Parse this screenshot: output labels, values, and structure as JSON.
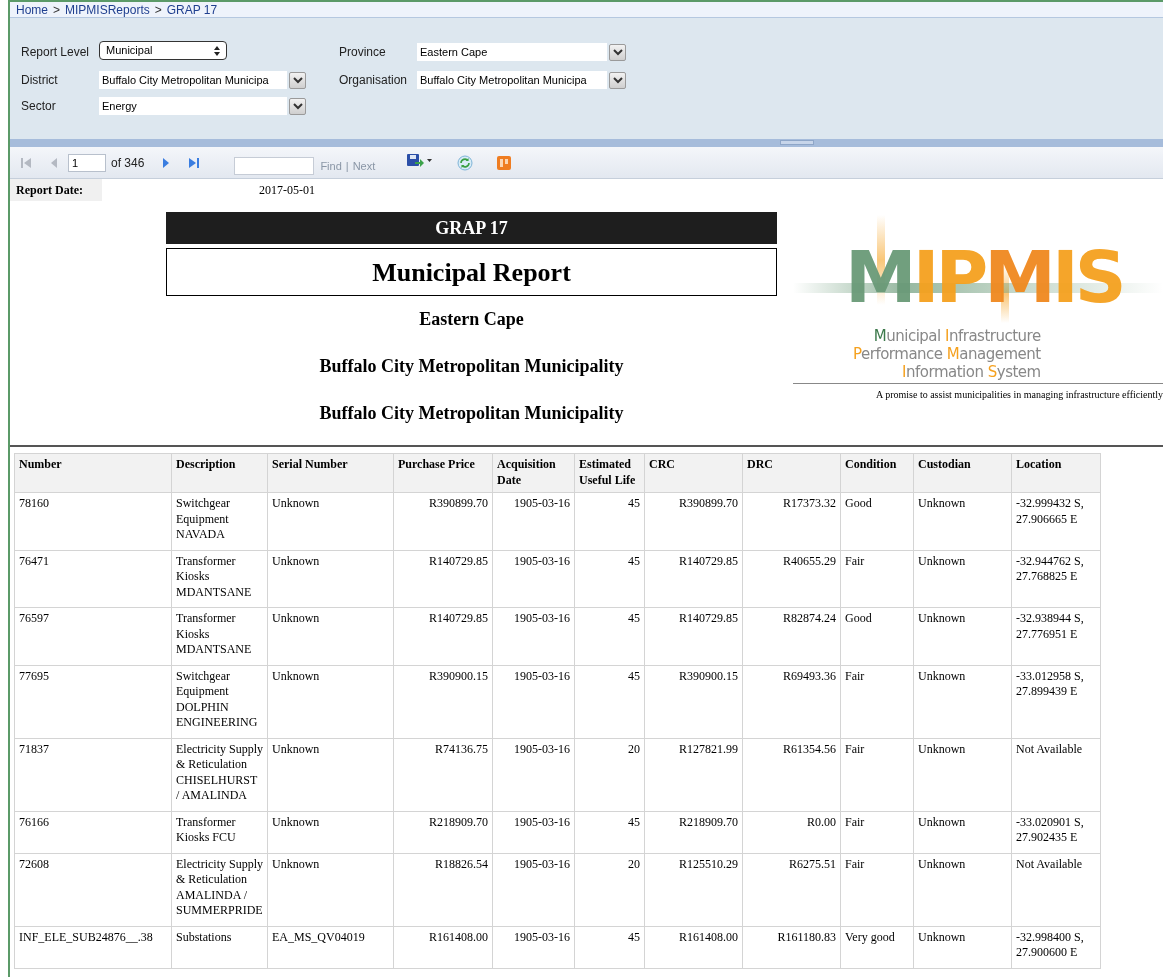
{
  "breadcrumb": [
    {
      "label": "Home",
      "separator": ">"
    },
    {
      "label": "MIPMISReports",
      "separator": ">"
    },
    {
      "label": "GRAP 17"
    }
  ],
  "filters": [
    {
      "label": "Report Level",
      "value": "Municipal",
      "kind": "select"
    },
    {
      "label": "Province",
      "value": "Eastern Cape",
      "kind": "combo"
    },
    {
      "label": "District",
      "value": "Buffalo City Metropolitan Municipa",
      "kind": "combo"
    },
    {
      "label": "Organisation",
      "value": "Buffalo City Metropolitan Municipa",
      "kind": "combo"
    },
    {
      "label": "Sector",
      "value": "Energy",
      "kind": "combo"
    }
  ],
  "toolbar": {
    "page": "1",
    "of": "of 346",
    "find": "Find",
    "separator": "|",
    "next": "Next"
  },
  "report": {
    "date_label": "Report Date:",
    "date": "2017-05-01",
    "banner": "GRAP 17",
    "title": "Municipal Report",
    "subtitles": [
      "Eastern Cape",
      "Buffalo City Metropolitan Municipality",
      "Buffalo City Metropolitan Municipality"
    ],
    "logo": {
      "letters": [
        {
          "char": "M",
          "color": "#6a9a78"
        },
        {
          "char": "I",
          "color": "#f5a11f"
        },
        {
          "char": "P",
          "color": "#f5a11f"
        },
        {
          "char": "M",
          "color": "#f0891f"
        },
        {
          "char": "I",
          "color": "#f5a11f"
        },
        {
          "char": "S",
          "color": "#f5a11f"
        }
      ],
      "lines": [
        "Municipal Infrastructure",
        "Performance Management",
        "Information System"
      ]
    },
    "tagline": "A promise to assist municipalities in managing infrastructure efficiently"
  },
  "table": {
    "columns": [
      "Number",
      "Description",
      "Serial Number",
      "Purchase Price",
      "Acquisition Date",
      "Estimated Useful Life",
      "CRC",
      "DRC",
      "Condition",
      "Custodian",
      "Location"
    ],
    "rows": [
      [
        "78160",
        "Switchgear Equipment NAVADA",
        "Unknown",
        "R390899.70",
        "1905-03-16",
        "45",
        "R390899.70",
        "R17373.32",
        "Good",
        "Unknown",
        "-32.999432 S, 27.906665 E"
      ],
      [
        "76471",
        "Transformer Kiosks MDANTSANE",
        "Unknown",
        "R140729.85",
        "1905-03-16",
        "45",
        "R140729.85",
        "R40655.29",
        "Fair",
        "Unknown",
        "-32.944762 S, 27.768825 E"
      ],
      [
        "76597",
        "Transformer Kiosks MDANTSANE",
        "Unknown",
        "R140729.85",
        "1905-03-16",
        "45",
        "R140729.85",
        "R82874.24",
        "Good",
        "Unknown",
        "-32.938944 S, 27.776951 E"
      ],
      [
        "77695",
        "Switchgear Equipment DOLPHIN ENGINEERING",
        "Unknown",
        "R390900.15",
        "1905-03-16",
        "45",
        "R390900.15",
        "R69493.36",
        "Fair",
        "Unknown",
        "-33.012958 S, 27.899439 E"
      ],
      [
        "71837",
        "Electricity Supply & Reticulation CHISELHURST / AMALINDA",
        "Unknown",
        "R74136.75",
        "1905-03-16",
        "20",
        "R127821.99",
        "R61354.56",
        "Fair",
        "Unknown",
        "Not Available"
      ],
      [
        "76166",
        "Transformer Kiosks  FCU",
        "Unknown",
        "R218909.70",
        "1905-03-16",
        "45",
        "R218909.70",
        "R0.00",
        "Fair",
        "Unknown",
        "-33.020901 S, 27.902435 E"
      ],
      [
        "72608",
        "Electricity Supply & Reticulation AMALINDA / SUMMERPRIDE",
        "Unknown",
        "R18826.54",
        "1905-03-16",
        "20",
        "R125510.29",
        "R6275.51",
        "Fair",
        "Unknown",
        "Not Available"
      ],
      [
        "INF_ELE_SUB24876__.38",
        "Substations",
        "EA_MS_QV04019",
        "R161408.00",
        "1905-03-16",
        "45",
        "R161408.00",
        "R161180.83",
        "Very good",
        "Unknown",
        "-32.998400 S, 27.900600 E"
      ]
    ]
  }
}
